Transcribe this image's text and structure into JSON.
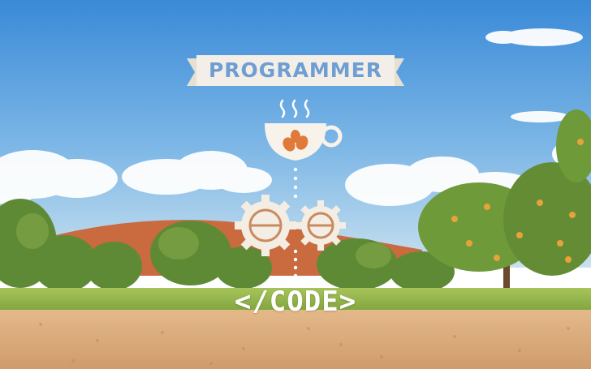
{
  "banner": {
    "title": "PROGRAMMER"
  },
  "footer_label": {
    "text": "</CODE>"
  },
  "icons": [
    "coffee-cup-icon",
    "steam-icon",
    "coffee-bean-icon",
    "gear-icon",
    "dotted-connector-icon"
  ],
  "colors": {
    "sky_top": "#3a8ad8",
    "sky_bottom": "#c9e1ef",
    "banner_fill": "#f3efe8",
    "banner_text": "#6f9ed3",
    "icon_white": "#ffffff",
    "bean_orange": "#e07a3a",
    "gear_fill": "#f4ede3",
    "hill": "#c96a3f",
    "grass": "#8fb24a",
    "soil": "#d9a875"
  }
}
